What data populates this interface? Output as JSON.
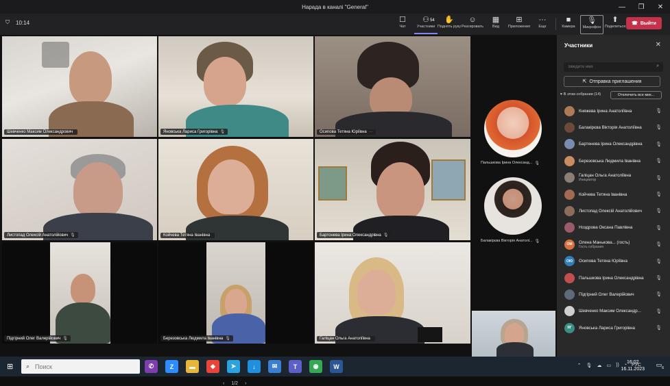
{
  "window": {
    "title": "Нарада в каналі \"General\"",
    "controls": [
      "—",
      "❐",
      "✕"
    ]
  },
  "toolbar": {
    "timer": "10:14",
    "buttons": [
      {
        "label": "Чат",
        "icon": "chat-icon",
        "glyph": "☐"
      },
      {
        "label": "Участники",
        "icon": "people-icon",
        "glyph": "⚇",
        "count": "54"
      },
      {
        "label": "Поднять руку",
        "icon": "hand-icon",
        "glyph": "✋"
      },
      {
        "label": "Реагировать",
        "icon": "smile-icon",
        "glyph": "☺"
      },
      {
        "label": "Вид",
        "icon": "view-icon",
        "glyph": "▦"
      },
      {
        "label": "Приложения",
        "icon": "apps-icon",
        "glyph": "⊞"
      },
      {
        "label": "Еще",
        "icon": "more-icon",
        "glyph": "···"
      }
    ],
    "device_buttons": [
      {
        "label": "Камера",
        "icon": "camera-icon",
        "glyph": "■"
      },
      {
        "label": "Микрофон",
        "icon": "microphone-icon",
        "glyph": "🎙"
      },
      {
        "label": "Поделиться",
        "icon": "share-icon",
        "glyph": "⬆"
      }
    ],
    "leave_label": "Выйти"
  },
  "tiles": [
    {
      "name": "Шевченко Максим Олександрович",
      "mic": ""
    },
    {
      "name": "Яновська Лариса Григорівна",
      "mic": "🎙"
    },
    {
      "name": "Осипова Тетяна Юріївна",
      "mic": "···"
    },
    {
      "name": "Листопад Олексій Анатолійович",
      "mic": "🎙"
    },
    {
      "name": "Койчева Тетяна Іванівна",
      "mic": ""
    },
    {
      "name": "Бартонева Ірина Олександрівна",
      "mic": "🎙"
    },
    {
      "name": "Підгірний Олег Валерійович",
      "mic": "🎙"
    },
    {
      "name": "Березовська Людмила Іванівна",
      "mic": "🎙"
    },
    {
      "name": "Галіцан Ольга Анатоліївна",
      "mic": ""
    }
  ],
  "rail": [
    {
      "name": "Пальшкова Ірина Олександ...",
      "mic": "🎙"
    },
    {
      "name": "Балакірєва Вікторія Анатолі...",
      "mic": "🎙"
    }
  ],
  "pager": {
    "prev": "‹",
    "page": "1/2",
    "next": "›"
  },
  "panel": {
    "title": "Участники",
    "close": "✕",
    "search_placeholder": "Введите имя",
    "invite_label": "Отправка приглашения",
    "section_label": "В этом собрании (14)",
    "mute_all_label": "Отключить все мик...",
    "participants": [
      {
        "name": "Княжева Ірина Анатоліївна",
        "sub": "",
        "initials": "",
        "color": "#b07a56",
        "mic": "🎙"
      },
      {
        "name": "Балакірєва Вікторія Анатоліївна",
        "sub": "",
        "initials": "",
        "color": "#6b4a3a",
        "mic": "🎙"
      },
      {
        "name": "Бартенева Ірина Олександрівна",
        "sub": "",
        "initials": "",
        "color": "#7a8db0",
        "mic": "🎙"
      },
      {
        "name": "Березовська Людмила Іванівна",
        "sub": "",
        "initials": "",
        "color": "#c98d62",
        "mic": "🎙"
      },
      {
        "name": "Галіцан Ольга Анатоліївна",
        "sub": "Инициатор",
        "initials": "",
        "color": "#8a7f77",
        "mic": "🎙"
      },
      {
        "name": "Койчева Тетяна Іванівна",
        "sub": "",
        "initials": "",
        "color": "#a06b52",
        "mic": "🎙"
      },
      {
        "name": "Листопад Олексій Анатолійович",
        "sub": "",
        "initials": "",
        "color": "#8c6d5c",
        "mic": "🎙"
      },
      {
        "name": "Ноздрова Оксана Павлівна",
        "sub": "",
        "initials": "",
        "color": "#9a5b6b",
        "mic": "🎙"
      },
      {
        "name": "Олена Манькова... (гость)",
        "sub": "Гость собрания",
        "initials": "ОМ",
        "color": "#d9713f",
        "mic": "🎙"
      },
      {
        "name": "Осипова Тетяна Юріївна",
        "sub": "",
        "initials": "ОЮ",
        "color": "#2f7fb8",
        "mic": "🎙"
      },
      {
        "name": "Пальшкова Ірина Олександрівна",
        "sub": "",
        "initials": "",
        "color": "#c0504d",
        "mic": "🎙"
      },
      {
        "name": "Підгірний Олег Валерійович",
        "sub": "",
        "initials": "",
        "color": "#5c6a7a",
        "mic": "🎙"
      },
      {
        "name": "Шевченко Максим Олександр...",
        "sub": "",
        "initials": "",
        "color": "#cfcfcf",
        "mic": "🎙"
      },
      {
        "name": "Яновська Лариса Григорівна",
        "sub": "",
        "initials": "ЯГ",
        "color": "#3a8f7d",
        "mic": "🎙"
      }
    ]
  },
  "taskbar": {
    "search_placeholder": "Поиск",
    "apps": [
      {
        "icon": "viber-icon",
        "glyph": "✆",
        "color": "#7d3daf"
      },
      {
        "icon": "zoom-icon",
        "glyph": "Z",
        "color": "#2d8cff"
      },
      {
        "icon": "folder-icon",
        "glyph": "▬",
        "color": "#e8b53b"
      },
      {
        "icon": "anydesk-icon",
        "glyph": "◆",
        "color": "#e8443a"
      },
      {
        "icon": "telegram-icon",
        "glyph": "➤",
        "color": "#2aa3df"
      },
      {
        "icon": "download-icon",
        "glyph": "↓",
        "color": "#1f8fe0"
      },
      {
        "icon": "mail-icon",
        "glyph": "✉",
        "color": "#3b7fd1"
      },
      {
        "icon": "teams-icon",
        "glyph": "T",
        "color": "#5b5fc7"
      },
      {
        "icon": "chrome-icon",
        "glyph": "◉",
        "color": "#34a853"
      },
      {
        "icon": "word-icon",
        "glyph": "W",
        "color": "#2b5797"
      }
    ],
    "tray": [
      "⌃",
      "🎙",
      "☁",
      "▭",
      "))",
      "◔",
      "РУС"
    ],
    "time": "16:02",
    "date": "16.11.2023",
    "notifications": "6"
  }
}
